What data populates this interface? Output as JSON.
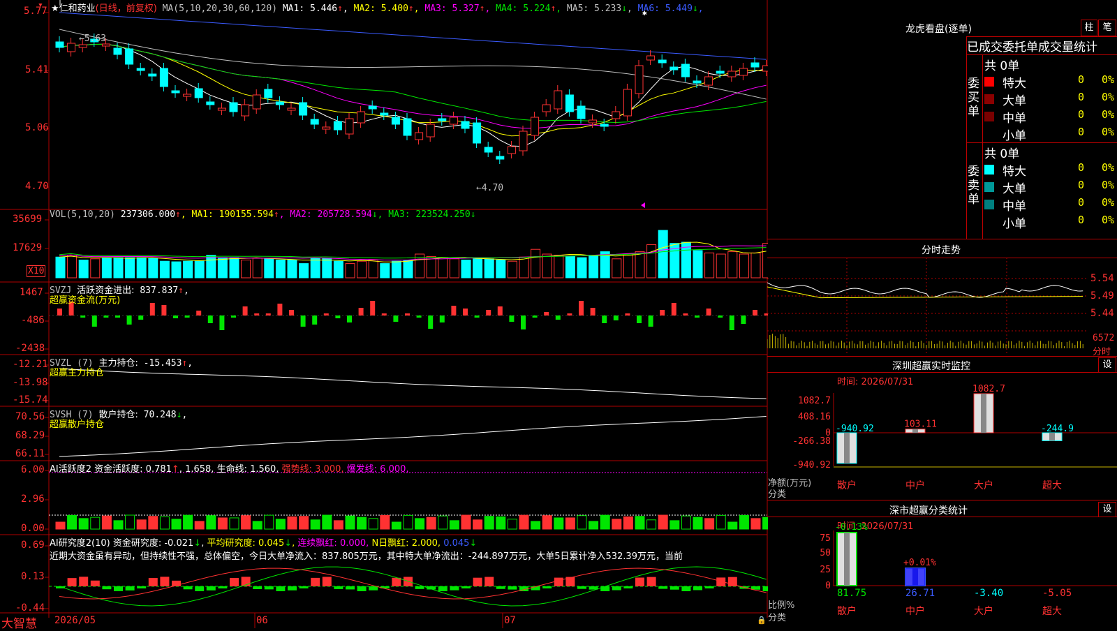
{
  "stock": {
    "name": "仁和药业",
    "mode": "(日线，前复权)"
  },
  "ma": {
    "title": "MA(5,10,20,30,60,120)",
    "items": [
      {
        "label": "MA1:",
        "value": "5.446",
        "arrow": "↑",
        "color": "#ffffff"
      },
      {
        "label": "MA2:",
        "value": "5.400",
        "arrow": "↑",
        "color": "#ffff00"
      },
      {
        "label": "MA3:",
        "value": "5.327",
        "arrow": "↑",
        "color": "#ff00ff"
      },
      {
        "label": "MA4:",
        "value": "5.224",
        "arrow": "↑",
        "color": "#00e600"
      },
      {
        "label": "MA5:",
        "value": "5.233",
        "arrow": "↓",
        "color": "#c0c0c0"
      },
      {
        "label": "MA6:",
        "value": "5.449",
        "arrow": "↓",
        "color": "#3b5bff"
      }
    ]
  },
  "price_axis": [
    "5.77",
    "5.41",
    "5.06",
    "4.70"
  ],
  "price_marks": {
    "high": "5.63",
    "low": "4.70"
  },
  "vol": {
    "title": "VOL(5,10,20)",
    "value": "237306.000",
    "arrow": "↑",
    "items": [
      {
        "label": "MA1:",
        "value": "190155.594",
        "arrow": "↑",
        "color": "#ffff00"
      },
      {
        "label": "MA2:",
        "value": "205728.594",
        "arrow": "↓",
        "color": "#ff00ff"
      },
      {
        "label": "MA3:",
        "value": "223524.250",
        "arrow": "↓",
        "color": "#00e600"
      }
    ],
    "axis": [
      "35699",
      "17629"
    ],
    "unit": "X10"
  },
  "svzj": {
    "title": "SVZJ",
    "label": "活跃资金进出:",
    "value": "837.837",
    "arrow": "↑",
    "sub": "超赢资金流(万元)",
    "axis": [
      "1467",
      "-486",
      "-2438"
    ]
  },
  "svzl": {
    "title": "SVZL (7)",
    "label": "主力持仓:",
    "value": "-15.453",
    "arrow": "↑",
    "sub": "超赢主力持仓",
    "axis": [
      "-12.21",
      "-13.98",
      "-15.74"
    ]
  },
  "svsh": {
    "title": "SVSH (7)",
    "label": "散户持仓:",
    "value": "70.248",
    "arrow": "↓",
    "sub": "超赢散户持仓",
    "axis": [
      "70.56",
      "68.29",
      "66.11"
    ]
  },
  "ai1": {
    "title": "AI活跃度2",
    "l1": "资金活跃度:",
    "v1": "0.781",
    "v1b": "1.658",
    "l2": "生命线:",
    "v2": "1.560",
    "l3": "强势线:",
    "v3": "3.000",
    "l4": "爆发线:",
    "v4": "6.000",
    "axis": [
      "6.00",
      "2.96",
      "0.00"
    ]
  },
  "ai2": {
    "title": "AI研究度2(10)",
    "l1": "资金研究度:",
    "v1": "-0.021",
    "l2": "平均研究度:",
    "v2": "0.045",
    "l3": "连续飘红:",
    "v3": "0.000",
    "l4": "N日飘红:",
    "v4": "2.000",
    "v5": "0.045",
    "text": "近期大资金虽有异动，但持续性不强，总体偏空，今日大单净流入：837.805万元，其中特大单净流出：-244.897万元，大单5日累计净入532.39万元，当前",
    "axis": [
      "0.69",
      "0.13",
      "-0.44"
    ]
  },
  "date_axis": [
    "2026/05",
    "06",
    "07"
  ],
  "brand": "大智慧",
  "dragon": {
    "title": "龙虎看盘(逐单)",
    "btn1": "柱",
    "btn2": "笔",
    "header": "已成交委托单成交量统计",
    "buy": {
      "side": "委买单",
      "total": "共 0单",
      "rows": [
        {
          "name": "特大",
          "v": "0",
          "p": "0%",
          "color": "#ff0000"
        },
        {
          "name": "大单",
          "v": "0",
          "p": "0%",
          "color": "#8b0000"
        },
        {
          "name": "中单",
          "v": "0",
          "p": "0%",
          "color": "#7a0000"
        },
        {
          "name": "小单",
          "v": "0",
          "p": "0%",
          "color": ""
        }
      ]
    },
    "sell": {
      "side": "委卖单",
      "total": "共 0单",
      "rows": [
        {
          "name": "特大",
          "v": "0",
          "p": "0%",
          "color": "#00ffff"
        },
        {
          "name": "大单",
          "v": "0",
          "p": "0%",
          "color": "#009999"
        },
        {
          "name": "中单",
          "v": "0",
          "p": "0%",
          "color": "#008080"
        },
        {
          "name": "小单",
          "v": "0",
          "p": "0%",
          "color": ""
        }
      ]
    }
  },
  "intraday": {
    "title": "分时走势",
    "axis": [
      "5.54",
      "5.49",
      "5.44"
    ],
    "vol": "6572",
    "vol_unit": "分时"
  },
  "monitor": {
    "title": "深圳超赢实时监控",
    "btn": "设",
    "time": "时间: 2026/07/31",
    "axis": [
      "1082.7",
      "408.16",
      "0",
      "-266.38",
      "-940.92"
    ],
    "ylabel": "净额(万元)",
    "xlabel": "分类",
    "bars": [
      {
        "cat": "散户",
        "value": "-940.92"
      },
      {
        "cat": "中户",
        "value": "103.11"
      },
      {
        "cat": "大户",
        "value": "1082.7"
      },
      {
        "cat": "超大",
        "value": "-244.9"
      }
    ]
  },
  "classify": {
    "title": "深市超赢分类统计",
    "btn": "设",
    "time": "时间: 2026/07/31",
    "axis": [
      "75",
      "50",
      "25",
      "0"
    ],
    "ylabel": "比例%",
    "xlabel": "分类",
    "bars": [
      {
        "cat": "散户",
        "pct": "81.75",
        "chg": "-0.13%"
      },
      {
        "cat": "中户",
        "pct": "26.71",
        "chg": "+0.01%"
      },
      {
        "cat": "大户",
        "pct": "-3.40",
        "chg": ""
      },
      {
        "cat": "超大",
        "pct": "-5.05",
        "chg": ""
      }
    ]
  },
  "colors": {
    "up": "#ff3232",
    "down": "#00ffff",
    "frame": "#b00000",
    "bg": "#000000"
  }
}
